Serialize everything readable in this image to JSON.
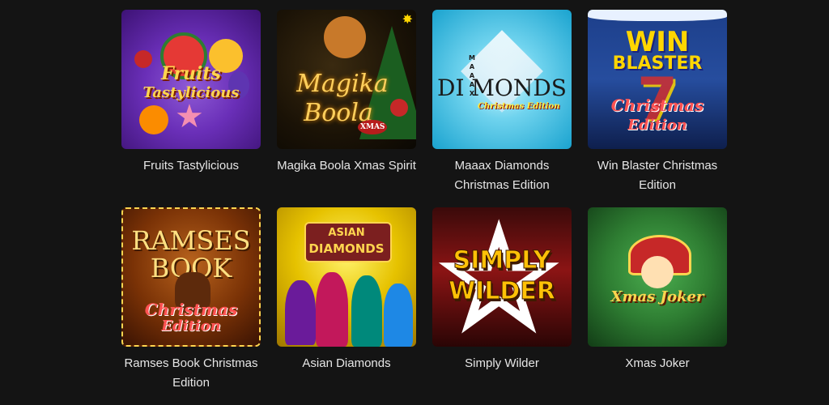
{
  "games": [
    {
      "title": "Fruits Tastylicious",
      "logo": [
        "Fruits",
        "Tastylicious"
      ]
    },
    {
      "title": "Magika Boola Xmas Spirit",
      "logo": [
        "Magika",
        "Boola",
        "XMAS"
      ]
    },
    {
      "title": "Maaax Diamonds Christmas Edition",
      "logo": [
        "DI",
        "MONDS",
        "MAAAX",
        "Christmas Edition"
      ]
    },
    {
      "title": "Win Blaster Christmas Edition",
      "logo": [
        "WIN",
        "BLASTER",
        "7",
        "Christmas",
        "Edition"
      ]
    },
    {
      "title": "Ramses Book Christmas Edition",
      "logo": [
        "RAMSES",
        "BOOK",
        "Christmas",
        "Edition"
      ]
    },
    {
      "title": "Asian Diamonds",
      "logo": [
        "ASIAN",
        "DIAMONDS"
      ]
    },
    {
      "title": "Simply Wilder",
      "logo": [
        "SIMPLY",
        "WILDER"
      ]
    },
    {
      "title": "Xmas Joker",
      "logo": [
        "Xmas Joker"
      ]
    }
  ]
}
